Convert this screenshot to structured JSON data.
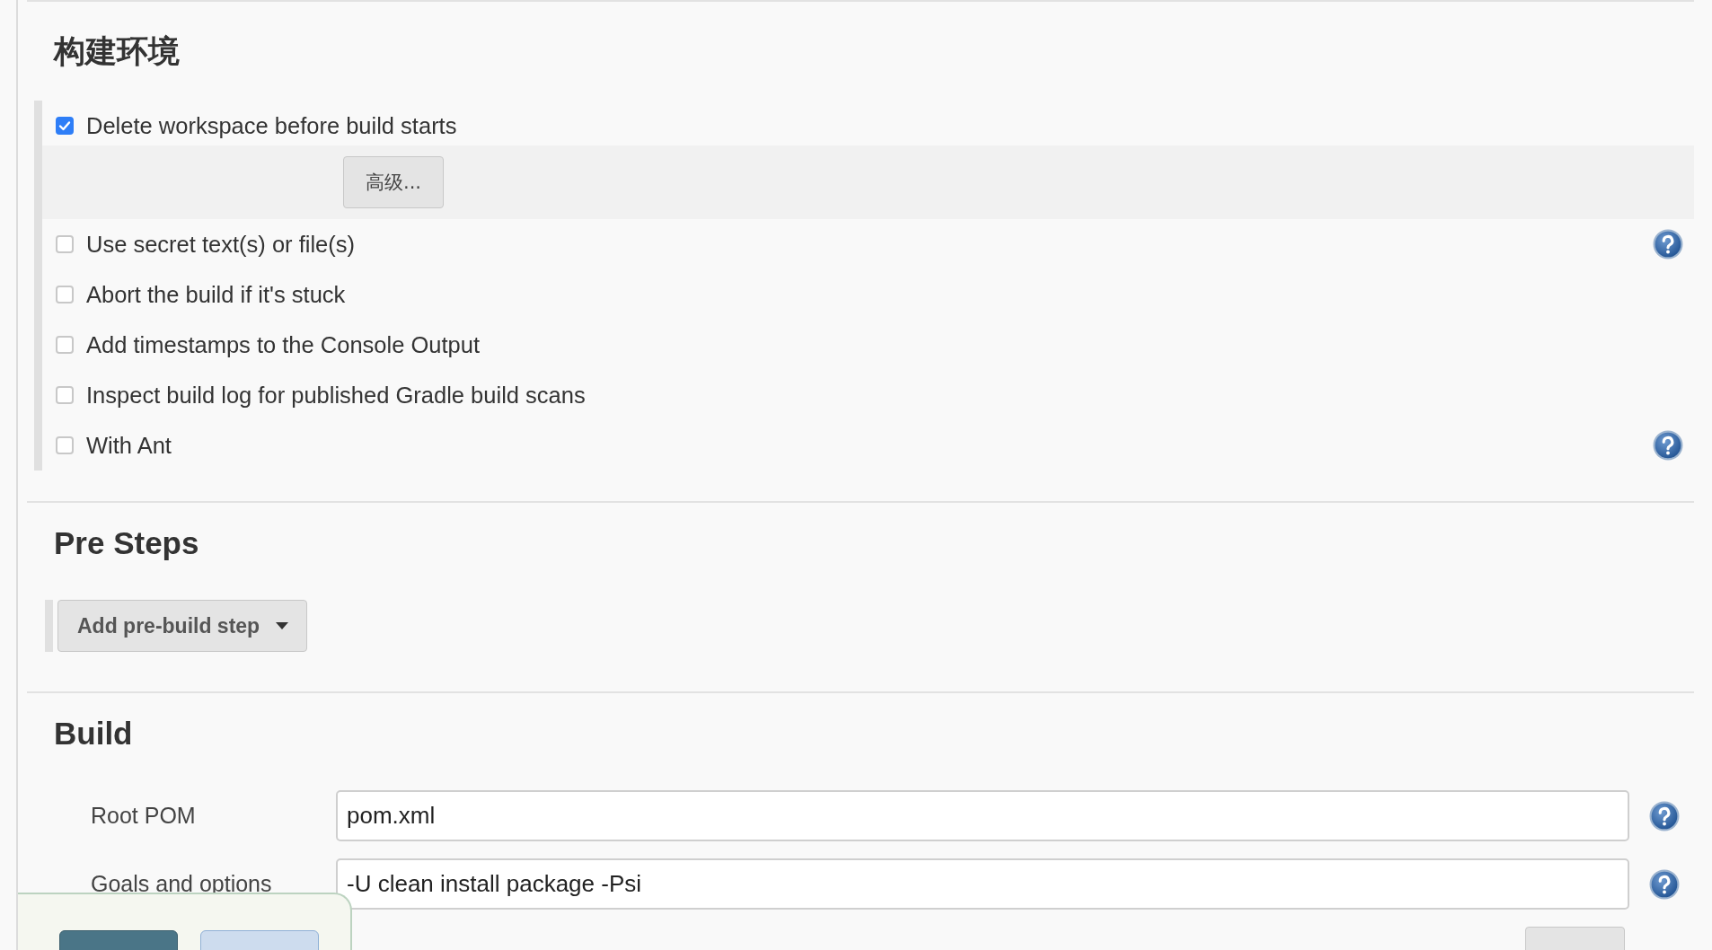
{
  "build_environment": {
    "title": "构建环境",
    "options": [
      {
        "label": "Delete workspace before build starts",
        "checked": true,
        "help": false,
        "advanced_button": "高级..."
      },
      {
        "label": "Use secret text(s) or file(s)",
        "checked": false,
        "help": true
      },
      {
        "label": "Abort the build if it's stuck",
        "checked": false,
        "help": false
      },
      {
        "label": "Add timestamps to the Console Output",
        "checked": false,
        "help": false
      },
      {
        "label": "Inspect build log for published Gradle build scans",
        "checked": false,
        "help": false
      },
      {
        "label": "With Ant",
        "checked": false,
        "help": true
      }
    ]
  },
  "pre_steps": {
    "title": "Pre Steps",
    "add_button": "Add pre-build step"
  },
  "build": {
    "title": "Build",
    "fields": [
      {
        "label": "Root POM",
        "value": "pom.xml",
        "help": true
      },
      {
        "label": "Goals and options",
        "value": "-U clean install package -Psi",
        "help": true
      }
    ],
    "advanced_button": true
  },
  "bottom_bar": {
    "buttons": [
      {
        "kind": "primary"
      },
      {
        "kind": "secondary"
      }
    ]
  }
}
